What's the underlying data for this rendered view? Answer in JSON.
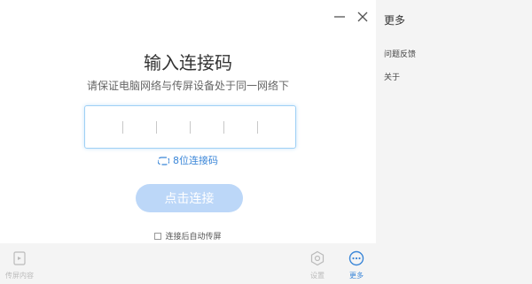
{
  "window": {
    "minimize_icon": "minimize-icon",
    "close_icon": "close-icon"
  },
  "main": {
    "title": "输入连接码",
    "subtitle": "请保证电脑网络与传屏设备处于同一网络下",
    "code_input": {
      "value": "",
      "slots": 5
    },
    "code_type_label": "8位连接码",
    "connect_label": "点击连接",
    "auto_cast_label": "连接后自动传屏",
    "auto_cast_checked": false
  },
  "bottom_bar": {
    "cast_content": "传屏内容",
    "settings": "设置",
    "more": "更多"
  },
  "side_panel": {
    "title": "更多",
    "items": [
      "问题反馈",
      "关于"
    ]
  },
  "colors": {
    "accent": "#3a86d8",
    "button_disabled": "#bcd7f8",
    "panel_bg": "#f4f4f4"
  }
}
